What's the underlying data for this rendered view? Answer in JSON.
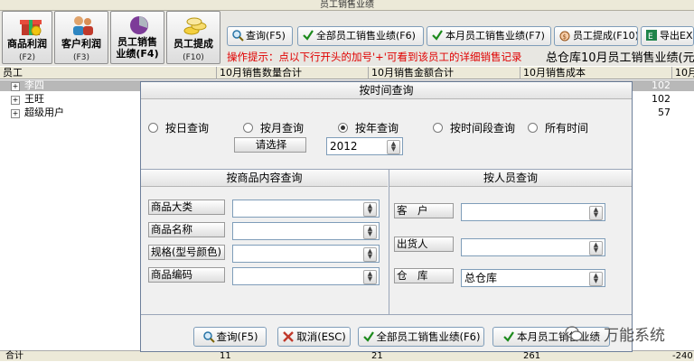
{
  "window": {
    "title": "员工销售业绩"
  },
  "toolbar": {
    "big": [
      {
        "label": "商品利润",
        "key": "(F2)"
      },
      {
        "label": "客户利润",
        "key": "(F3)"
      },
      {
        "label": "员工销售业绩(F4)",
        "line1": "员工销售",
        "line2": "业绩(F4)"
      },
      {
        "label": "员工提成",
        "key": "(F10)"
      }
    ],
    "small": [
      {
        "label": "查询(F5)"
      },
      {
        "label": "全部员工销售业绩(F6)"
      },
      {
        "label": "本月员工销售业绩(F7)"
      },
      {
        "label": "员工提成(F10)"
      },
      {
        "label": "导出EX"
      }
    ],
    "tip": "操作提示：点以下行开头的加号'+'可看到该员工的详细销售记录",
    "report_title": "总仓库10月员工销售业绩(元"
  },
  "grid": {
    "headers": [
      "员工",
      "10月销售数量合计",
      "10月销售金额合计",
      "10月销售成本",
      "10月"
    ],
    "rows": [
      {
        "name": "李四",
        "right": "102"
      },
      {
        "name": "王旺",
        "right": "102"
      },
      {
        "name": "超级用户",
        "right": "57"
      }
    ],
    "footer": {
      "label": "合计",
      "c1": "11",
      "c2": "21",
      "c3": "261",
      "c4": "-240"
    }
  },
  "dialog": {
    "time_section": "按时间查询",
    "radios": [
      {
        "label": "按日查询",
        "selected": false
      },
      {
        "label": "按月查询",
        "selected": false
      },
      {
        "label": "按年查询",
        "selected": true
      },
      {
        "label": "按时间段查询",
        "selected": false
      },
      {
        "label": "所有时间",
        "selected": false
      }
    ],
    "select_label": "请选择",
    "year_value": "2012",
    "product_section": "按商品内容查询",
    "product_fields": [
      {
        "label": "商品大类",
        "value": ""
      },
      {
        "label": "商品名称",
        "value": ""
      },
      {
        "label": "规格(型号颜色)",
        "value": ""
      },
      {
        "label": "商品编码",
        "value": ""
      }
    ],
    "person_section": "按人员查询",
    "person_fields": [
      {
        "label": "客　户",
        "value": ""
      },
      {
        "label": "出货人",
        "value": ""
      },
      {
        "label": "仓　库",
        "value": "总仓库"
      }
    ],
    "buttons": [
      {
        "label": "查询(F5)"
      },
      {
        "label": "取消(ESC)"
      },
      {
        "label": "全部员工销售业绩(F6)"
      },
      {
        "label": "本月员工销售业绩"
      }
    ]
  },
  "watermark": {
    "text": "万能系统"
  },
  "colors": {
    "tip_red": "#e00000",
    "check_green": "#1c8a1c",
    "dialog_bg": "#f0f0f0"
  }
}
